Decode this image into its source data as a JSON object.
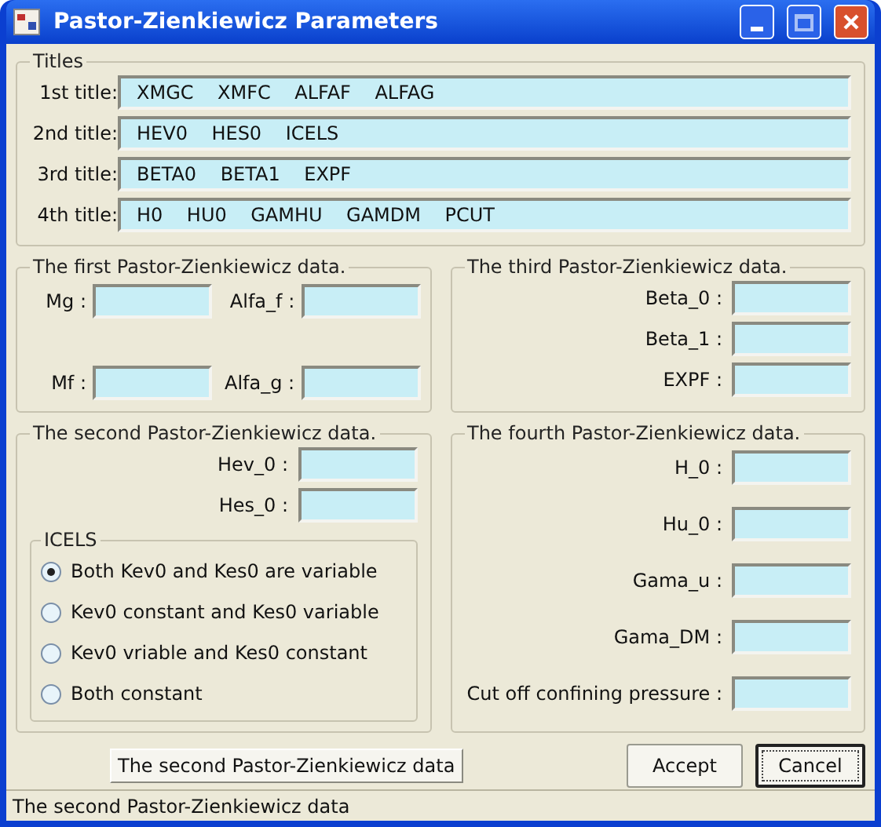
{
  "window": {
    "title": "Pastor-Zienkiewicz Parameters"
  },
  "titles": {
    "legend": "Titles",
    "rows": [
      {
        "label": "1st title:",
        "value": "XMGC    XMFC    ALFAF    ALFAG"
      },
      {
        "label": "2nd title:",
        "value": "HEV0    HES0    ICELS"
      },
      {
        "label": "3rd title:",
        "value": "BETA0    BETA1    EXPF"
      },
      {
        "label": "4th title:",
        "value": "H0    HU0    GAMHU    GAMDM    PCUT"
      }
    ]
  },
  "first": {
    "legend": "The first Pastor-Zienkiewicz data.",
    "fields": [
      {
        "label": "Mg :"
      },
      {
        "label": "Alfa_f :"
      },
      {
        "label": "Mf :"
      },
      {
        "label": "Alfa_g :"
      }
    ]
  },
  "third": {
    "legend": "The third Pastor-Zienkiewicz data.",
    "fields": [
      {
        "label": "Beta_0 :"
      },
      {
        "label": "Beta_1 :"
      },
      {
        "label": "EXPF :"
      }
    ]
  },
  "second": {
    "legend": "The second Pastor-Zienkiewicz data.",
    "fields": [
      {
        "label": "Hev_0 :"
      },
      {
        "label": "Hes_0 :"
      }
    ],
    "icels": {
      "legend": "ICELS",
      "options": [
        {
          "label": "Both Kev0 and Kes0 are variable",
          "selected": true
        },
        {
          "label": "Kev0 constant and Kes0 variable",
          "selected": false
        },
        {
          "label": "Kev0 vriable and Kes0 constant",
          "selected": false
        },
        {
          "label": "Both constant",
          "selected": false
        }
      ]
    }
  },
  "fourth": {
    "legend": "The fourth Pastor-Zienkiewicz data.",
    "fields": [
      {
        "label": "H_0 :"
      },
      {
        "label": "Hu_0 :"
      },
      {
        "label": "Gama_u :"
      },
      {
        "label": "Gama_DM :"
      },
      {
        "label": "Cut off confining pressure :"
      }
    ]
  },
  "buttons": {
    "section": "The second Pastor-Zienkiewicz data",
    "accept": "Accept",
    "cancel": "Cancel"
  },
  "status_bar": "The second Pastor-Zienkiewicz data"
}
